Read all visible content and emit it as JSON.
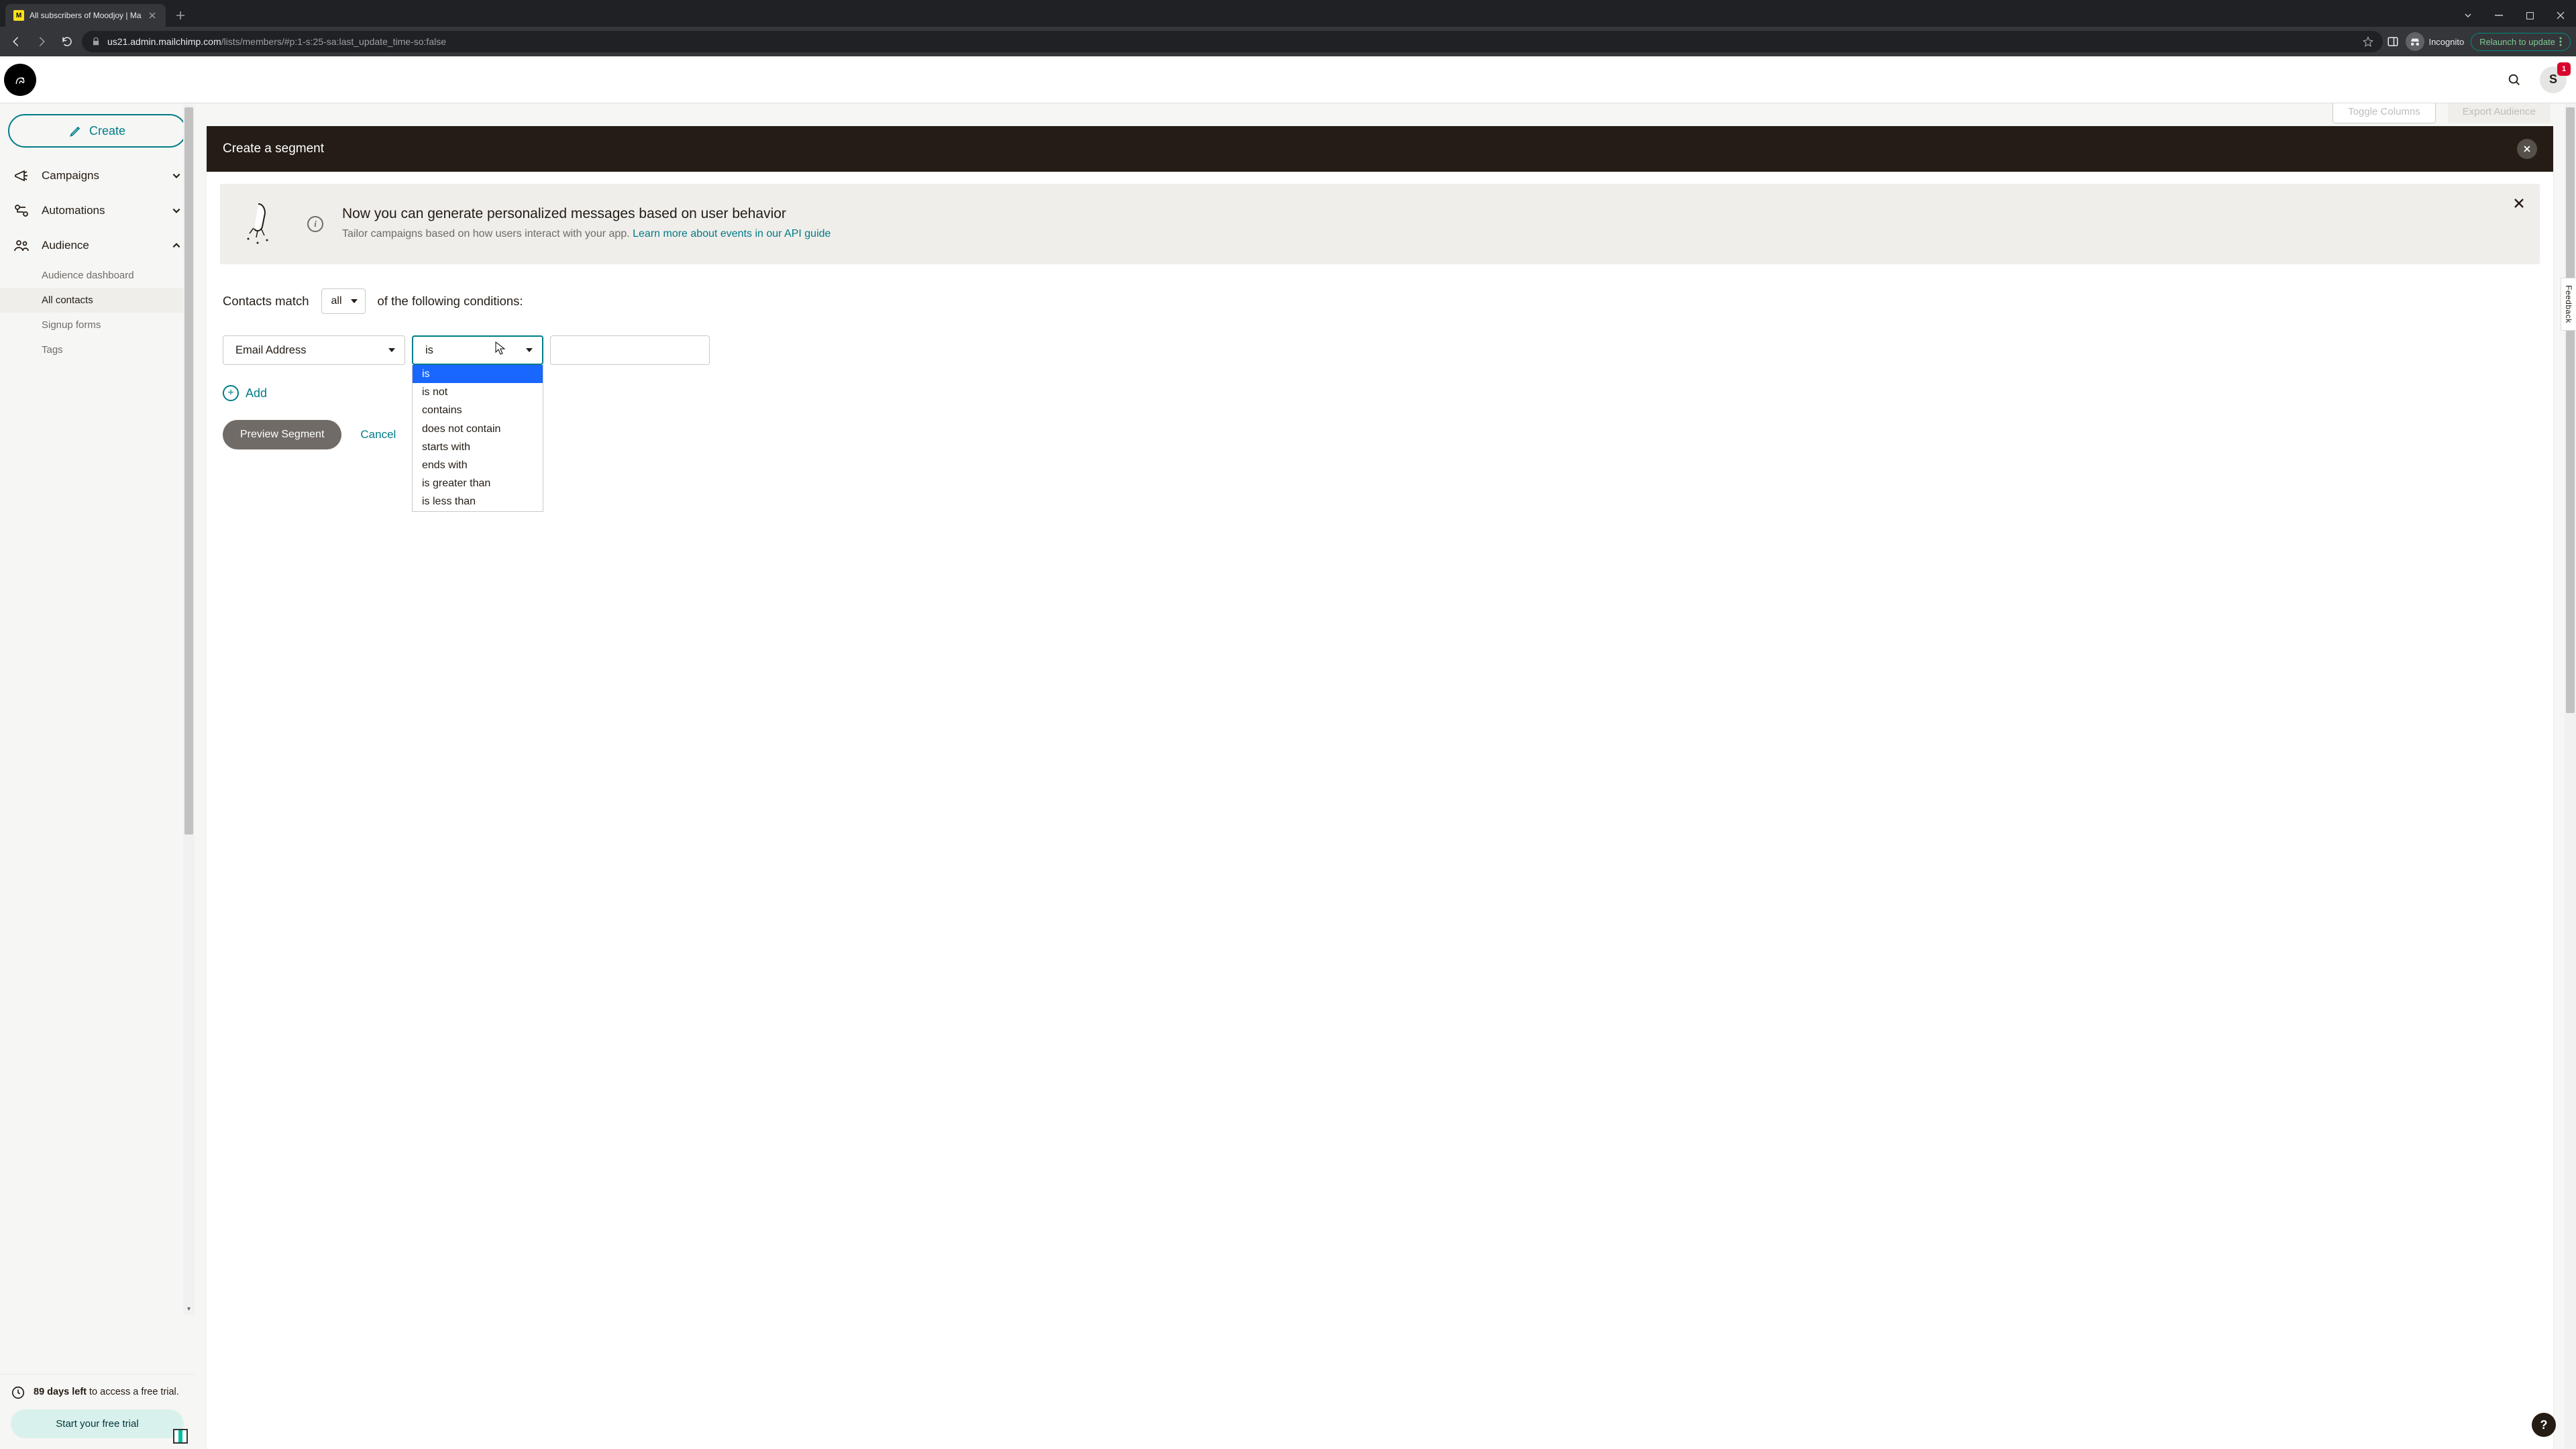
{
  "browser": {
    "tab_title": "All subscribers of Moodjoy | Ma",
    "url_host": "us21.admin.mailchimp.com",
    "url_path": "/lists/members/#p:1-s:25-sa:last_update_time-so:false",
    "incognito_label": "Incognito",
    "relaunch_label": "Relaunch to update"
  },
  "header": {
    "avatar_initial": "S",
    "notif_count": "1"
  },
  "sidebar": {
    "create_label": "Create",
    "items": [
      {
        "label": "Campaigns",
        "expanded": false
      },
      {
        "label": "Automations",
        "expanded": false
      },
      {
        "label": "Audience",
        "expanded": true
      }
    ],
    "audience_sub": [
      {
        "label": "Audience dashboard",
        "active": false
      },
      {
        "label": "All contacts",
        "active": true
      },
      {
        "label": "Signup forms",
        "active": false
      },
      {
        "label": "Tags",
        "active": false
      }
    ],
    "trial": {
      "days_prefix": "89 days left",
      "days_rest": " to access a free trial.",
      "cta": "Start your free trial"
    }
  },
  "top_buttons": {
    "toggle": "Toggle Columns",
    "export": "Export Audience"
  },
  "panel": {
    "title": "Create a segment",
    "notice": {
      "heading": "Now you can generate personalized messages based on user behavior",
      "body": "Tailor campaigns based on how users interact with your app. ",
      "link": "Learn more about events in our API guide"
    },
    "match_pre": "Contacts match",
    "match_sel": "all",
    "match_post": "of the following conditions:",
    "field_sel": "Email Address",
    "op_sel": "is",
    "op_options": [
      "is",
      "is not",
      "contains",
      "does not contain",
      "starts with",
      "ends with",
      "is greater than",
      "is less than"
    ],
    "value": "",
    "add_label": "Add",
    "preview_label": "Preview Segment",
    "cancel_label": "Cancel"
  },
  "misc": {
    "feedback": "Feedback",
    "help": "?"
  }
}
